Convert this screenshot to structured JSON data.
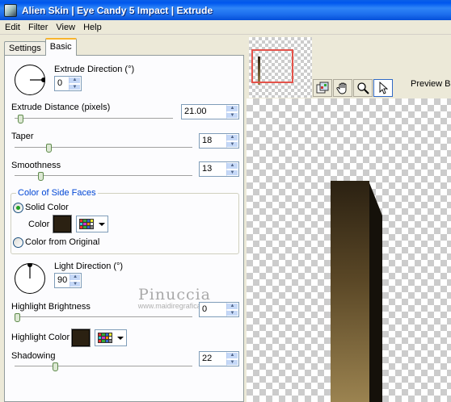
{
  "window": {
    "title": "Alien Skin  |  Eye Candy 5 Impact  |  Extrude",
    "app_icon": "alien-skin-icon"
  },
  "menu": {
    "items": [
      "Edit",
      "Filter",
      "View",
      "Help"
    ]
  },
  "tabs": [
    {
      "label": "Settings",
      "active": false
    },
    {
      "label": "Basic",
      "active": true
    }
  ],
  "basic": {
    "extrude_direction": {
      "label": "Extrude Direction (°)",
      "value": "0"
    },
    "extrude_distance": {
      "label": "Extrude Distance (pixels)",
      "value": "21.00",
      "slider_fraction": 0.04
    },
    "taper": {
      "label": "Taper",
      "value": "18",
      "slider_fraction": 0.18
    },
    "smoothness": {
      "label": "Smoothness",
      "value": "13",
      "slider_fraction": 0.13
    },
    "side_faces": {
      "group_title": "Color of Side Faces",
      "solid_color_label": "Solid Color",
      "color_label": "Color",
      "color_from_original_label": "Color from Original",
      "selected": "Solid Color",
      "swatch_color": "#2B2112"
    },
    "light_direction": {
      "label": "Light Direction (°)",
      "value": "90"
    },
    "highlight_brightness": {
      "label": "Highlight Brightness",
      "value": "0",
      "slider_fraction": 0.0
    },
    "highlight_color": {
      "label": "Highlight Color",
      "swatch_color": "#2B2112"
    },
    "shadowing": {
      "label": "Shadowing",
      "value": "22",
      "slider_fraction": 0.22
    }
  },
  "watermark": {
    "line1": "Pinuccia",
    "line2": "www.maidiregrafica.eu"
  },
  "preview": {
    "label": "Preview Ba",
    "tools": [
      "preview-toggle-icon",
      "hand-icon",
      "zoom-icon",
      "arrow-pointer-icon"
    ]
  },
  "colors": {
    "title_bar": "#0058EE",
    "group_title": "#0046D5",
    "object_dark": "#2B2112",
    "object_light": "#9B8350",
    "nav_frame": "#E5534B"
  }
}
